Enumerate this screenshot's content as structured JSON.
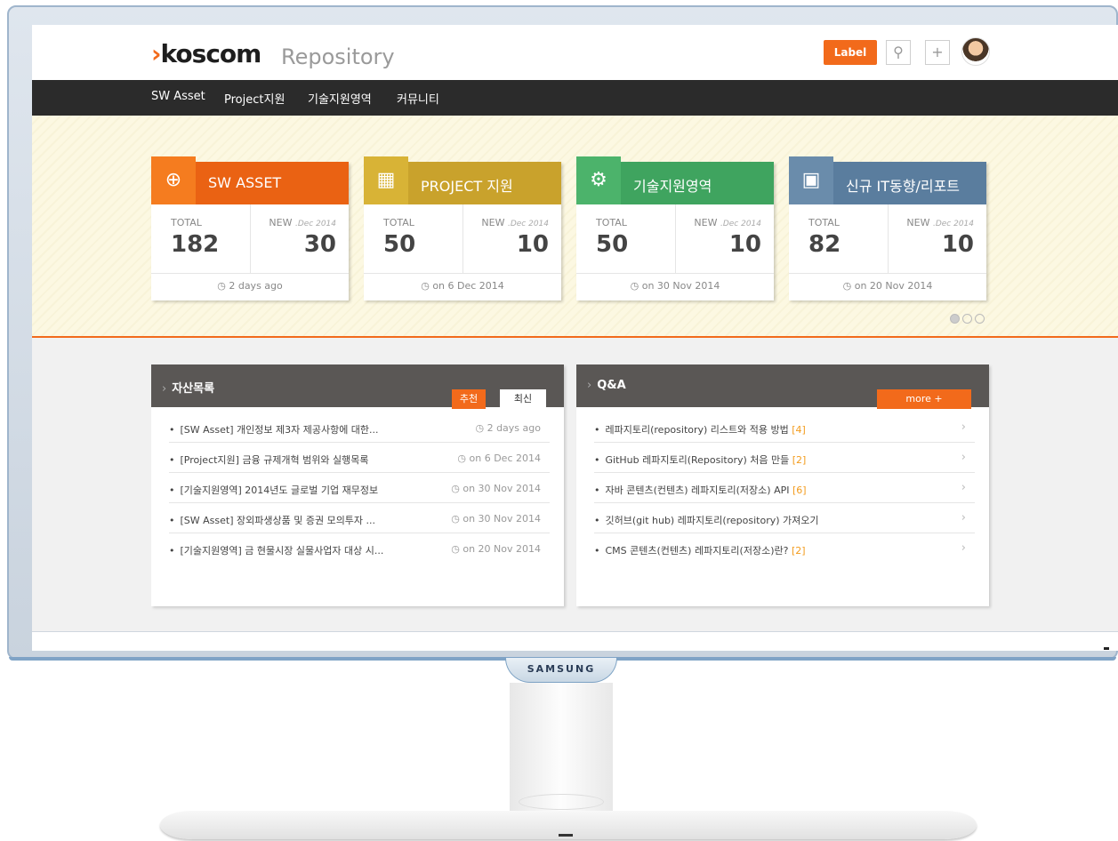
{
  "header": {
    "logo_chevron": "›",
    "logo_main": "koscom",
    "logo_sub": "Repository",
    "label_button": "Label",
    "search_glyph": "⚲",
    "add_glyph": "+"
  },
  "nav": [
    "SW Asset",
    "Project지원",
    "기술지원영역",
    "커뮤니티"
  ],
  "cards": [
    {
      "icon": "globe-icon",
      "glyph": "⊕",
      "title": "SW ASSET",
      "color": "#ea6213",
      "icon_bg": "#f57c1f",
      "total_label": "TOTAL",
      "total": "182",
      "new_label": "NEW",
      "new_date": ".Dec 2014",
      "new": "30",
      "footer": "2 days ago"
    },
    {
      "icon": "presentation-icon",
      "glyph": "▦",
      "title": "PROJECT 지원",
      "color": "#c9a22c",
      "icon_bg": "#d8b336",
      "total_label": "TOTAL",
      "total": "50",
      "new_label": "NEW",
      "new_date": ".Dec 2014",
      "new": "10",
      "footer": "on 6 Dec 2014"
    },
    {
      "icon": "gear-icon",
      "glyph": "⚙",
      "title": "기술지원영역",
      "color": "#3fa45f",
      "icon_bg": "#4cb36b",
      "total_label": "TOTAL",
      "total": "50",
      "new_label": "NEW",
      "new_date": ".Dec 2014",
      "new": "10",
      "footer": "on 30 Nov 2014"
    },
    {
      "icon": "puzzle-icon",
      "glyph": "▣",
      "title": "신규 IT동향/리포트",
      "color": "#5a7d9e",
      "icon_bg": "#6a8cab",
      "total_label": "TOTAL",
      "total": "82",
      "new_label": "NEW",
      "new_date": ".Dec 2014",
      "new": "10",
      "footer": "on 20 Nov 2014"
    }
  ],
  "asset_panel": {
    "title": "자산목록",
    "tab_recommended": "추천",
    "tab_latest": "최신",
    "rows": [
      {
        "text": "[SW Asset] 개인정보 제3자 제공사항에 대한...",
        "date": "2 days ago"
      },
      {
        "text": "[Project지원] 금융 규제개혁 범위와 실행목록",
        "date": "on 6 Dec 2014"
      },
      {
        "text": "[기술지원영역] 2014년도 글로벌 기업 재무정보",
        "date": "on 30 Nov 2014"
      },
      {
        "text": "[SW Asset] 장외파생상품 및 증권 모의투자 ...",
        "date": "on 30 Nov 2014"
      },
      {
        "text": "[기술지원영역] 금 현물시장 실물사업자 대상 시...",
        "date": "on 20 Nov 2014"
      }
    ]
  },
  "qa_panel": {
    "title": "Q&A",
    "more": "more +",
    "rows": [
      {
        "text": "레파지토리(repository) 리스트와 적용 방법",
        "count": "[4]"
      },
      {
        "text": "GitHub 레파지토리(Repository) 처음 만들",
        "count": "[2]"
      },
      {
        "text": "자바 콘텐츠(컨텐츠) 레파지토리(저장소) API",
        "count": "[6]"
      },
      {
        "text": "깃허브(git hub) 레파지토리(repository) 가져오기",
        "count": ""
      },
      {
        "text": "CMS 콘텐츠(컨텐츠) 레파지토리(저장소)란?",
        "count": "[2]"
      }
    ]
  },
  "monitor_brand": "SAMSUNG",
  "clock_glyph": "◷",
  "bullet_glyph": "•",
  "chevron_glyph": "›"
}
